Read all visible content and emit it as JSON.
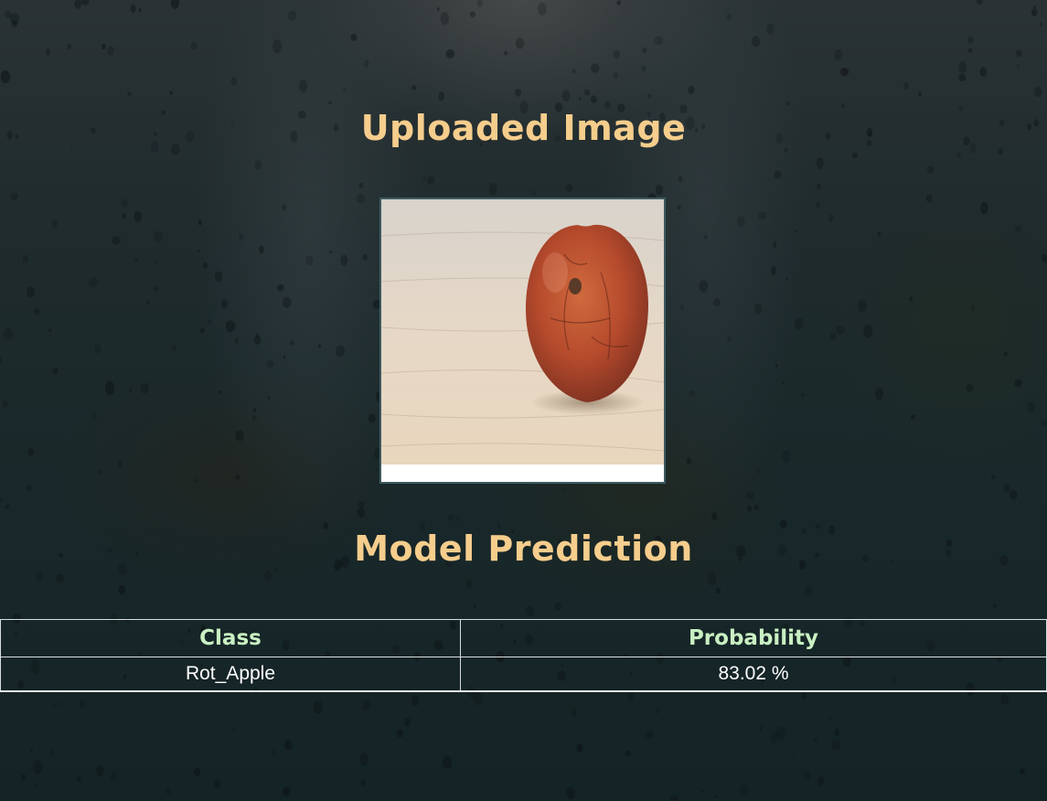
{
  "page": {
    "uploaded_title": "Uploaded Image",
    "prediction_title": "Model Prediction"
  },
  "uploaded_image": {
    "subject": "rotten-apple-photo"
  },
  "prediction_table": {
    "headers": [
      "Class",
      "Probability"
    ],
    "rows": [
      {
        "class": "Rot_Apple",
        "probability": "83.02 %"
      }
    ]
  },
  "colors": {
    "heading": "#f5cd8c",
    "table_header": "#c9f0c2",
    "table_text": "#ffffff",
    "background": "#1c2a2c"
  }
}
